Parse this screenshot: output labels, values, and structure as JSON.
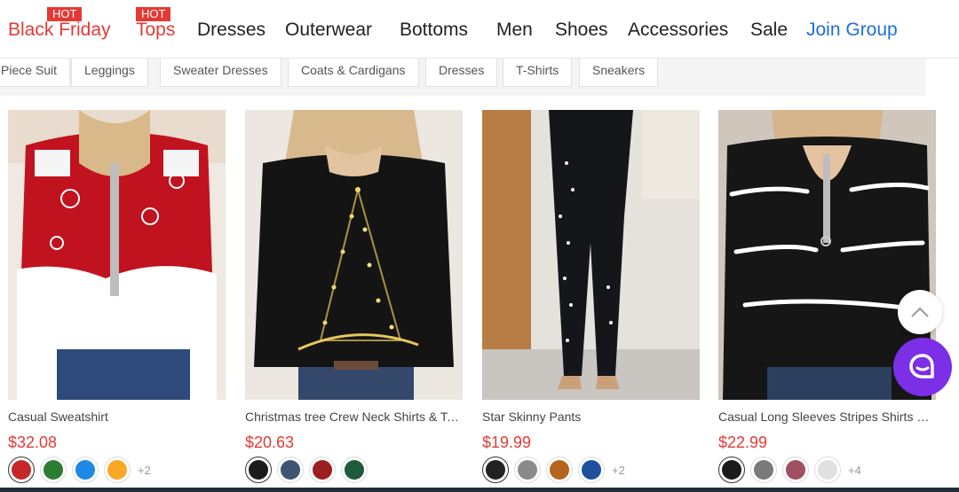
{
  "nav": {
    "items": [
      {
        "label": "Black Friday",
        "badge": "HOT",
        "color": "#e53935"
      },
      {
        "label": "Tops",
        "badge": "HOT",
        "color": "#e53935"
      },
      {
        "label": "Dresses"
      },
      {
        "label": "Outerwear"
      },
      {
        "label": "Bottoms"
      },
      {
        "label": "Men"
      },
      {
        "label": "Shoes"
      },
      {
        "label": "Accessories"
      },
      {
        "label": "Sale"
      },
      {
        "label": "Join Group",
        "color": "#1e6fd9"
      }
    ]
  },
  "subcategories": [
    "Piece Suit",
    "Leggings",
    "Sweater Dresses",
    "Coats & Cardigans",
    "Dresses",
    "T-Shirts",
    "Sneakers"
  ],
  "products": [
    {
      "name": "Casual Sweatshirt",
      "price": "$32.08",
      "more": "+2",
      "swatches": [
        "#c62828",
        "#2e7d32",
        "#1e88e5",
        "#f9a825"
      ]
    },
    {
      "name": "Christmas tree Crew Neck Shirts & Tops",
      "price": "$20.63",
      "more": "",
      "swatches": [
        "#1b1b1b",
        "#3e5575",
        "#9c1f1f",
        "#1f5a3a"
      ]
    },
    {
      "name": "Star Skinny Pants",
      "price": "$19.99",
      "more": "+2",
      "swatches": [
        "#222222",
        "#8a8a8a",
        "#b5651d",
        "#1e4f9c"
      ]
    },
    {
      "name": "Casual Long Sleeves Stripes Shirts & Tops",
      "price": "$22.99",
      "more": "+4",
      "swatches": [
        "#1a1a1a",
        "#7a7a7a",
        "#a05060",
        "#e0e0e0"
      ]
    }
  ],
  "colors": {
    "accent_red": "#e53935",
    "link_blue": "#1e6fd9",
    "chat_purple": "#7b2fe6"
  },
  "icons": {
    "scroll_top": "chevron-up-icon",
    "chat": "chat-bubble-icon"
  }
}
